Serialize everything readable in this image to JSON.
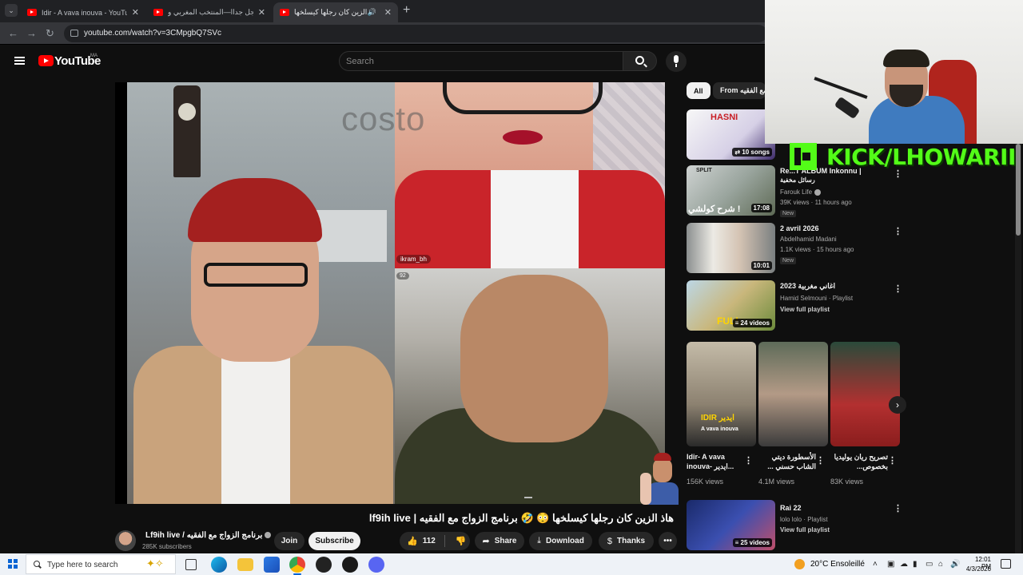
{
  "browser": {
    "tabs": [
      {
        "label": "Idir - A vava inouva - YouTube",
        "active": false
      },
      {
        "label": "عااجل جداا—المنتخب المغربي و",
        "active": false
      },
      {
        "label": "هاذ الزين كان رجلها كيسلخها",
        "active": true
      }
    ],
    "new_tab_label": "+",
    "url": "youtube.com/watch?v=3CMpgbQ7SVc"
  },
  "youtube": {
    "logo_text": "YouTube",
    "region": "MA",
    "search_placeholder": "Search"
  },
  "video": {
    "watermark": "costo",
    "overlay_username": "ikram_bh",
    "overlay_viewers": "92",
    "title": "هاذ الزين كان رجلها كيسلخها 😳 🤣 برنامج الزواج مع الفقيه | lf9ih live",
    "channel_name": "Lf9ih live / برنامج الزواج مع الفقيه",
    "subscribers": "285K subscribers",
    "join_label": "Join",
    "subscribe_label": "Subscribe",
    "like_count": "112",
    "share_label": "Share",
    "download_label": "Download",
    "thanks_label": "Thanks"
  },
  "sidebar": {
    "chips": [
      {
        "label": "All",
        "selected": true
      },
      {
        "label": "From برنامج الزواج مع الفقيه",
        "selected": false
      }
    ],
    "recommendations": [
      {
        "thumb_text": "HASNI",
        "badge": "10 songs",
        "title": "",
        "channel": "",
        "meta": "",
        "new": ""
      },
      {
        "thumb_text": "شرح كولشي !",
        "thumb_text2": "SPLIT",
        "badge": "17:08",
        "title": "Re...T ALBUM Inkonnu |",
        "subtitle": "رسائل مخفية",
        "channel": "Farouk Life",
        "meta": "39K views · 11 hours ago",
        "new": "New"
      },
      {
        "badge": "10:01",
        "title": "2 avril 2026",
        "channel": "Abdelhamid Madani",
        "meta": "1.1K views · 15 hours ago",
        "new": "New"
      },
      {
        "thumb_text": "FULL",
        "badge": "24 videos",
        "title": "اغاني مغربية 2023",
        "channel": "Hamid Selmouni · Playlist",
        "meta": "View full playlist",
        "new": ""
      },
      {
        "badge": "25 videos",
        "title": "Rai 22",
        "channel": "lolo lolo · Playlist",
        "meta": "View full playlist",
        "new": ""
      }
    ],
    "shorts": [
      {
        "thumb_text": "IDIR ايدير",
        "thumb_sub": "A vava inouva",
        "title": "Idir- A vava inouva- ايدير...",
        "views": "156K views"
      },
      {
        "title": "الأسطورة ديتي الشاب حسني ...",
        "views": "4.1M views"
      },
      {
        "title": "تصريح ريان يوليديا بخصوص...",
        "views": "83K views"
      }
    ]
  },
  "overlay": {
    "kick_text": "KICK/LHOWARII"
  },
  "taskbar": {
    "search_placeholder": "Type here to search",
    "weather": "20°C  Ensoleillé",
    "time": "12:01 PM",
    "date": "4/3/2026"
  },
  "colors": {
    "youtube_red": "#ff0000",
    "background": "#0f0f0f",
    "kick_green": "#53fc18"
  }
}
